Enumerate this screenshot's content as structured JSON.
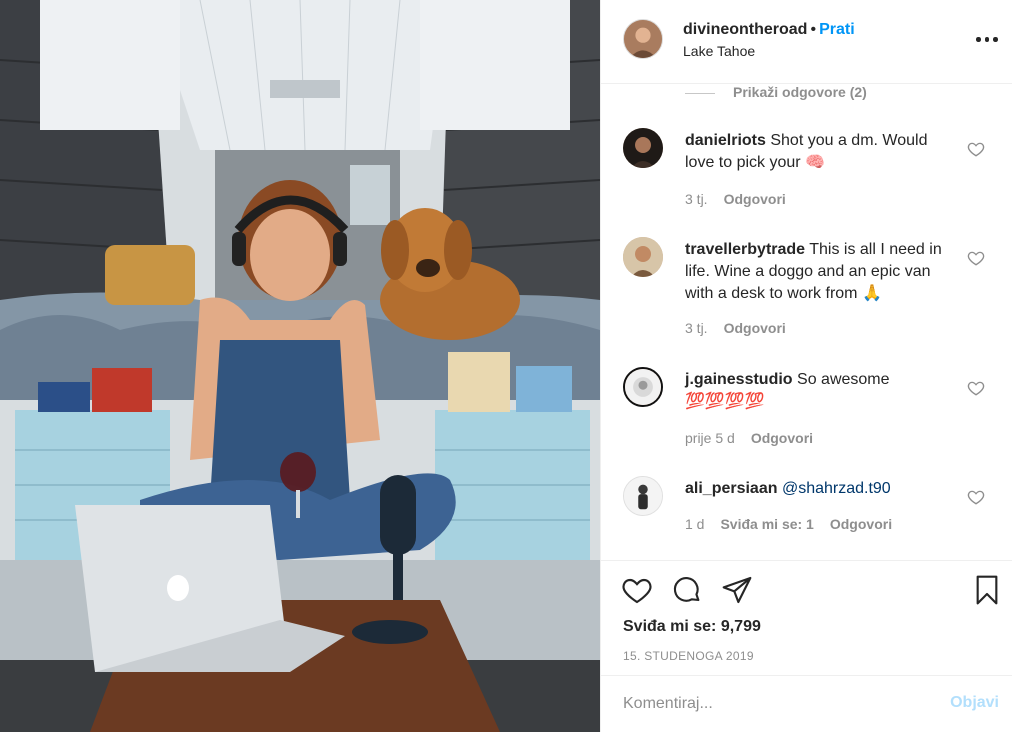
{
  "post": {
    "username": "divineontheroad",
    "separator": "•",
    "follow_label": "Prati",
    "location": "Lake Tahoe"
  },
  "comments": {
    "view_replies_label": "Prikaži odgovore (2)",
    "items": [
      {
        "username": "danielriots",
        "text": "Shot you a dm. Would love to pick your 🧠",
        "time": "3 tj.",
        "likes_label": "",
        "reply_label": "Odgovori"
      },
      {
        "username": "travellerbytrade",
        "text": "This is all I need in life. Wine a doggo and an epic van with a desk to work from 🙏",
        "time": "3 tj.",
        "likes_label": "",
        "reply_label": "Odgovori"
      },
      {
        "username": "j.gainesstudio",
        "text": "So awesome 💯💯💯💯",
        "time": "prije 5 d",
        "likes_label": "",
        "reply_label": "Odgovori"
      },
      {
        "username": "ali_persiaan",
        "mention": "@shahrzad.t90",
        "time": "1 d",
        "likes_label": "Sviđa mi se: 1",
        "reply_label": "Odgovori"
      }
    ]
  },
  "actions": {
    "likes_text": "Sviđa mi se: 9,799",
    "date": "15. STUDENOGA 2019"
  },
  "add_comment": {
    "placeholder": "Komentiraj...",
    "post_label": "Objavi"
  },
  "colors": {
    "accent": "#0095f6",
    "text": "#262626",
    "muted": "#8e8e8e",
    "post_disabled": "#b2dffc",
    "border": "#efefef"
  },
  "icons": {
    "header": "more-options-icon",
    "actions": [
      "heart-icon",
      "comment-icon",
      "share-icon",
      "bookmark-icon"
    ],
    "comment_like": "heart-outline-icon"
  }
}
